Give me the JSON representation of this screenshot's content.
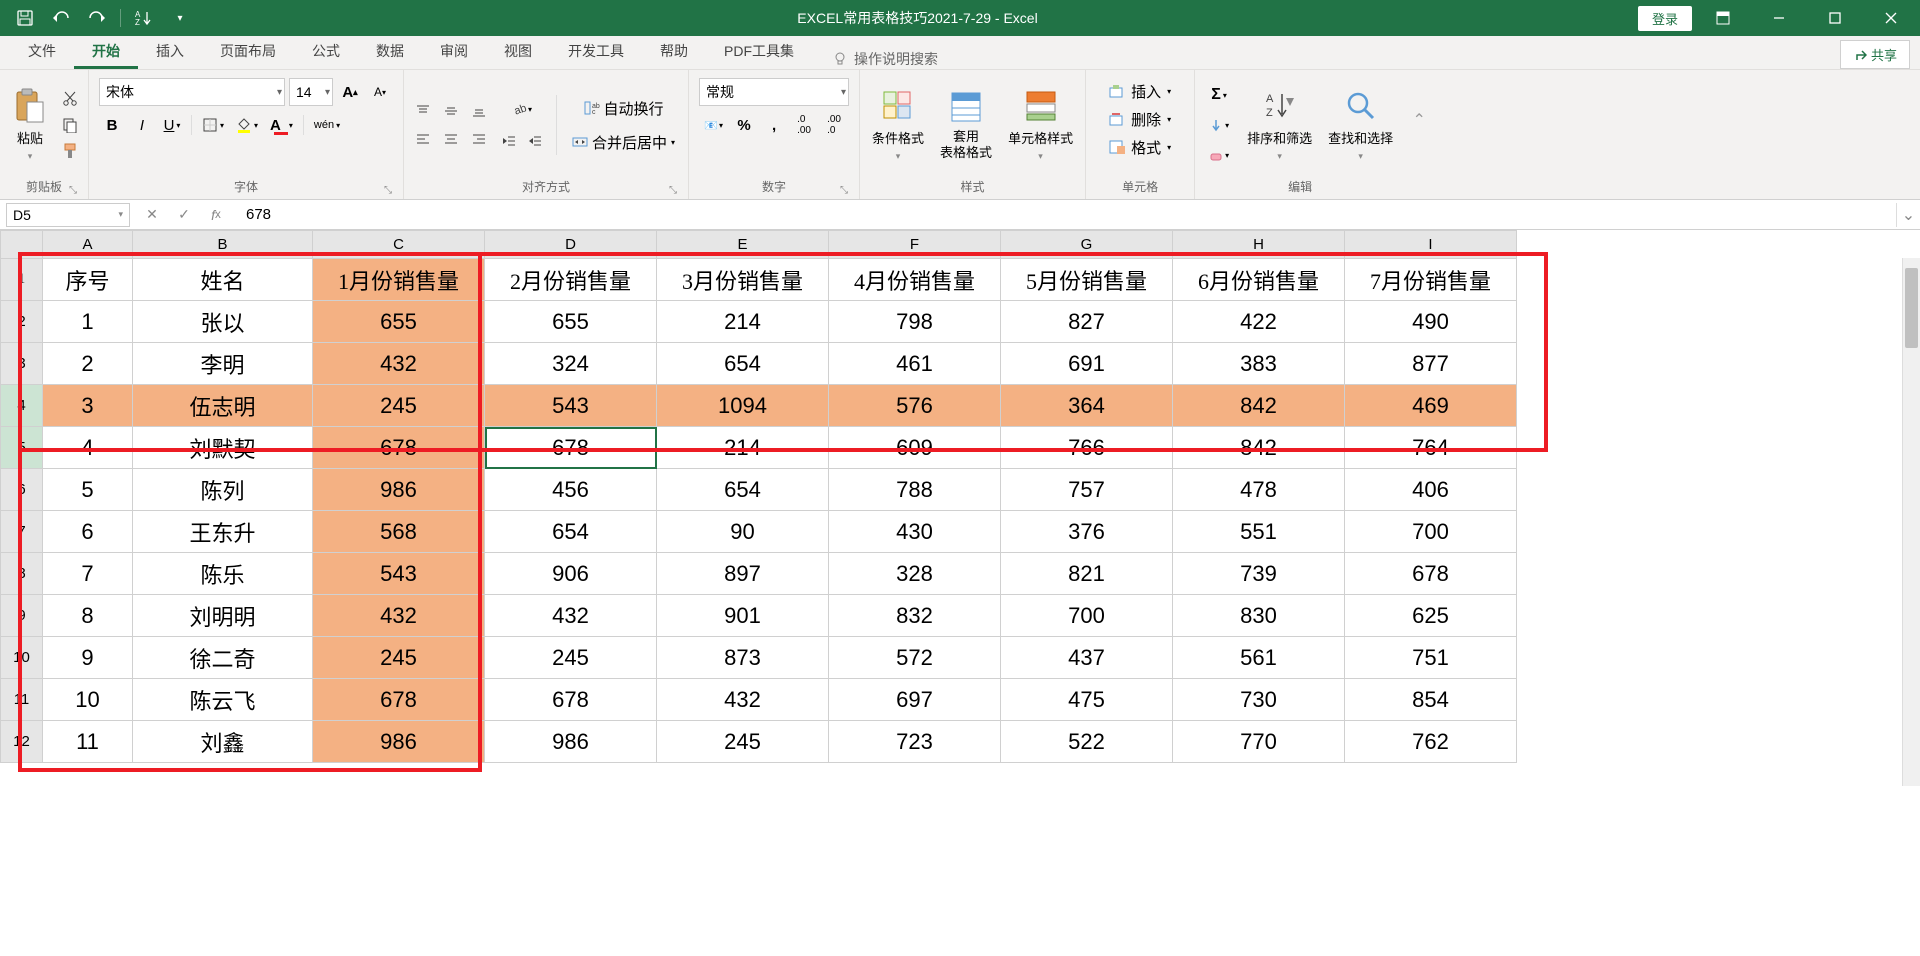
{
  "title": "EXCEL常用表格技巧2021-7-29  -  Excel",
  "login": "登录",
  "share": "共享",
  "tabs": [
    "文件",
    "开始",
    "插入",
    "页面布局",
    "公式",
    "数据",
    "审阅",
    "视图",
    "开发工具",
    "帮助",
    "PDF工具集"
  ],
  "active_tab": 1,
  "tell_me": "操作说明搜索",
  "ribbon": {
    "clipboard": {
      "paste": "粘贴",
      "label": "剪贴板"
    },
    "font": {
      "name": "宋体",
      "size": "14",
      "label": "字体"
    },
    "align": {
      "wrap": "自动换行",
      "merge": "合并后居中",
      "label": "对齐方式"
    },
    "number": {
      "format": "常规",
      "label": "数字"
    },
    "styles": {
      "cond": "条件格式",
      "table": "套用\n表格格式",
      "cell": "单元格样式",
      "label": "样式"
    },
    "cells": {
      "insert": "插入",
      "delete": "删除",
      "format": "格式",
      "label": "单元格"
    },
    "editing": {
      "sort": "排序和筛选",
      "find": "查找和选择",
      "label": "编辑"
    }
  },
  "namebox": "D5",
  "formula": "678",
  "columns": [
    "A",
    "B",
    "C",
    "D",
    "E",
    "F",
    "G",
    "H",
    "I"
  ],
  "headers": [
    "序号",
    "姓名",
    "1月份销售量",
    "2月份销售量",
    "3月份销售量",
    "4月份销售量",
    "5月份销售量",
    "6月份销售量",
    "7月份销售量"
  ],
  "rows": [
    {
      "n": 1,
      "name": "张以",
      "v": [
        655,
        655,
        214,
        798,
        827,
        422,
        490
      ]
    },
    {
      "n": 2,
      "name": "李明",
      "v": [
        432,
        324,
        654,
        461,
        691,
        383,
        877
      ]
    },
    {
      "n": 3,
      "name": "伍志明",
      "v": [
        245,
        543,
        1094,
        576,
        364,
        842,
        469
      ],
      "orange_row": true
    },
    {
      "n": 4,
      "name": "刘默契",
      "v": [
        678,
        678,
        214,
        609,
        766,
        842,
        764
      ]
    },
    {
      "n": 5,
      "name": "陈列",
      "v": [
        986,
        456,
        654,
        788,
        757,
        478,
        406
      ]
    },
    {
      "n": 6,
      "name": "王东升",
      "v": [
        568,
        654,
        90,
        430,
        376,
        551,
        700
      ]
    },
    {
      "n": 7,
      "name": "陈乐",
      "v": [
        543,
        906,
        897,
        328,
        821,
        739,
        678
      ]
    },
    {
      "n": 8,
      "name": "刘明明",
      "v": [
        432,
        432,
        901,
        832,
        700,
        830,
        625
      ]
    },
    {
      "n": 9,
      "name": "徐二奇",
      "v": [
        245,
        245,
        873,
        572,
        437,
        561,
        751
      ]
    },
    {
      "n": 10,
      "name": "陈云飞",
      "v": [
        678,
        678,
        432,
        697,
        475,
        730,
        854
      ]
    },
    {
      "n": 11,
      "name": "刘鑫",
      "v": [
        986,
        986,
        245,
        723,
        522,
        770,
        762
      ]
    }
  ],
  "active_cell": {
    "row": 4,
    "col": "D"
  }
}
